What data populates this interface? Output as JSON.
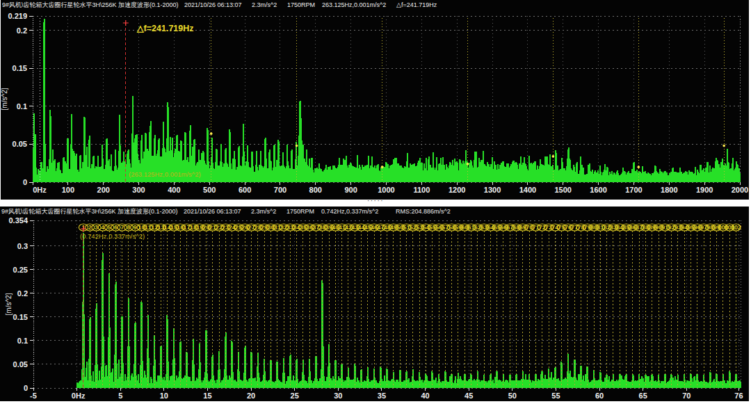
{
  "app": {
    "background": "#ffffff",
    "panel_background": "#040404"
  },
  "splitter": {
    "dots": "·····"
  },
  "panels": [
    {
      "header": {
        "title": "9#风机\\齿轮箱大齿圈行星轮水平3H\\256K 加速度波形(0.1-2000)",
        "datetime": "2021/10/26 06:13:07",
        "amplitude": "2.3m/s^2",
        "speed": "1750RPM",
        "cursor_readout": "263.125Hz,0.001m/s^2",
        "extra": "△f=241.719Hz"
      }
    },
    {
      "header": {
        "title": "9#风机\\齿轮箱大齿圈行星轮水平3H\\256K 加速度波形(0.1-2000)",
        "datetime": "2021/10/26 06:13:07",
        "amplitude": "2.3m/s^2",
        "speed": "1750RPM",
        "cursor_readout": "0.742Hz,0.337m/s^2",
        "extra": "RMS:204.886m/s^2"
      }
    }
  ],
  "chart_data": [
    {
      "type": "line",
      "kind": "fft-spectrum",
      "title": "9#风机\\齿轮箱大齿圈行星轮水平3H\\256K 加速度波形(0.1-2000)",
      "xlabel": "Hz",
      "ylabel": "[m/s^2]",
      "xlim": [
        0,
        2000
      ],
      "ylim": [
        0,
        0.219
      ],
      "grid": true,
      "legend": "none",
      "line_color": "#27e027",
      "xticks": [
        0,
        100,
        200,
        300,
        400,
        500,
        600,
        700,
        800,
        900,
        1000,
        1100,
        1200,
        1300,
        1400,
        1500,
        1600,
        1700,
        1800,
        1900,
        2000
      ],
      "xtick_labels": [
        "0Hz",
        "100",
        "200",
        "300",
        "400",
        "500",
        "600",
        "700",
        "800",
        "900",
        "1000",
        "1100",
        "1200",
        "1300",
        "1400",
        "1500",
        "1600",
        "1700",
        "1800",
        "1900",
        "2000"
      ],
      "yticks": [
        0,
        0.05,
        0.1,
        0.15,
        0.2,
        0.219
      ],
      "ytick_labels": [
        "0",
        "0.05",
        "0.1",
        "0.15",
        "0.2",
        "0.219"
      ],
      "annotations": {
        "delta_f": "△f=241.719Hz",
        "cursor_readout": "(263.125Hz,0.001m/s^2)"
      },
      "cursor": {
        "freq": 263.125,
        "amp": 0.001,
        "color": "#d43030",
        "style": "dashed"
      },
      "sideband_delta": 241.719,
      "sideband_cursors": [
        {
          "freq": 21.406,
          "color": "#e8e8e8"
        },
        {
          "freq": 504.844,
          "color": "#cdbd2e",
          "dot_amp": 0.064
        },
        {
          "freq": 746.563,
          "color": "#cdbd2e",
          "dot_amp": 0.048
        },
        {
          "freq": 988.281,
          "color": "#cdbd2e",
          "dot_amp": 0.02
        },
        {
          "freq": 1230.0,
          "color": "#cdbd2e",
          "dot_amp": 0.024
        },
        {
          "freq": 1471.719,
          "color": "#cdbd2e",
          "dot_amp": 0.034
        },
        {
          "freq": 1713.438,
          "color": "#cdbd2e",
          "dot_amp": 0.02
        },
        {
          "freq": 1955.156,
          "color": "#cdbd2e",
          "dot_amp": 0.048
        }
      ],
      "noise_floor": [
        [
          0,
          0.013
        ],
        [
          240,
          0.017
        ],
        [
          280,
          0.026
        ],
        [
          330,
          0.034
        ],
        [
          390,
          0.034
        ],
        [
          430,
          0.03
        ],
        [
          470,
          0.023
        ],
        [
          520,
          0.017
        ],
        [
          700,
          0.016
        ],
        [
          790,
          0.015
        ],
        [
          850,
          0.017
        ],
        [
          1000,
          0.018
        ],
        [
          1250,
          0.021
        ],
        [
          1400,
          0.02
        ],
        [
          1470,
          0.018
        ],
        [
          1560,
          0.012
        ],
        [
          1740,
          0.011
        ],
        [
          1870,
          0.011
        ],
        [
          1910,
          0.015
        ],
        [
          1955,
          0.018
        ],
        [
          2000,
          0.014
        ]
      ],
      "peaks": [
        [
          4,
          0.088
        ],
        [
          7,
          0.062
        ],
        [
          33,
          0.212,
          1.8
        ],
        [
          25,
          0.028
        ],
        [
          50,
          0.094
        ],
        [
          57,
          0.044
        ],
        [
          63,
          0.03
        ],
        [
          75,
          0.028
        ],
        [
          87,
          0.032
        ],
        [
          99,
          0.057
        ],
        [
          110,
          0.093
        ],
        [
          117,
          0.04
        ],
        [
          123,
          0.038
        ],
        [
          135,
          0.036
        ],
        [
          147,
          0.091
        ],
        [
          153,
          0.05
        ],
        [
          160,
          0.06
        ],
        [
          172,
          0.036
        ],
        [
          185,
          0.036
        ],
        [
          197,
          0.052
        ],
        [
          209,
          0.057
        ],
        [
          222,
          0.036
        ],
        [
          234,
          0.042
        ],
        [
          246,
          0.092
        ],
        [
          258,
          0.042
        ],
        [
          270,
          0.042
        ],
        [
          283,
          0.117
        ],
        [
          290,
          0.06
        ],
        [
          295,
          0.068
        ],
        [
          308,
          0.048
        ],
        [
          320,
          0.066
        ],
        [
          333,
          0.078
        ],
        [
          345,
          0.062
        ],
        [
          357,
          0.057
        ],
        [
          370,
          0.077
        ],
        [
          382,
          0.107
        ],
        [
          389,
          0.06
        ],
        [
          395,
          0.058
        ],
        [
          408,
          0.062
        ],
        [
          420,
          0.057
        ],
        [
          432,
          0.064
        ],
        [
          445,
          0.072
        ],
        [
          457,
          0.057
        ],
        [
          470,
          0.042
        ],
        [
          483,
          0.042
        ],
        [
          495,
          0.072
        ],
        [
          507,
          0.058
        ],
        [
          520,
          0.044
        ],
        [
          533,
          0.054
        ],
        [
          546,
          0.044
        ],
        [
          558,
          0.067
        ],
        [
          570,
          0.044
        ],
        [
          583,
          0.049
        ],
        [
          596,
          0.074
        ],
        [
          608,
          0.048
        ],
        [
          620,
          0.042
        ],
        [
          633,
          0.044
        ],
        [
          645,
          0.042
        ],
        [
          658,
          0.057
        ],
        [
          670,
          0.042
        ],
        [
          683,
          0.048
        ],
        [
          695,
          0.057
        ],
        [
          708,
          0.042
        ],
        [
          720,
          0.048
        ],
        [
          733,
          0.044
        ],
        [
          745,
          0.054
        ],
        [
          753,
          0.062
        ],
        [
          756,
          0.116
        ],
        [
          758,
          0.085
        ],
        [
          761,
          0.055
        ],
        [
          765,
          0.05
        ],
        [
          775,
          0.042
        ],
        [
          790,
          0.032
        ],
        [
          810,
          0.026
        ],
        [
          830,
          0.024
        ],
        [
          850,
          0.022
        ],
        [
          875,
          0.024
        ],
        [
          900,
          0.026
        ],
        [
          925,
          0.022
        ],
        [
          950,
          0.024
        ],
        [
          975,
          0.022
        ],
        [
          1000,
          0.026
        ],
        [
          1030,
          0.024
        ],
        [
          1060,
          0.024
        ],
        [
          1090,
          0.028
        ],
        [
          1120,
          0.026
        ],
        [
          1150,
          0.024
        ],
        [
          1180,
          0.026
        ],
        [
          1210,
          0.028
        ],
        [
          1240,
          0.03
        ],
        [
          1270,
          0.03
        ],
        [
          1300,
          0.032
        ],
        [
          1330,
          0.028
        ],
        [
          1360,
          0.028
        ],
        [
          1390,
          0.028
        ],
        [
          1420,
          0.03
        ],
        [
          1450,
          0.034
        ],
        [
          1480,
          0.042
        ],
        [
          1497,
          0.048,
          5
        ],
        [
          1515,
          0.053,
          7
        ],
        [
          1530,
          0.046,
          5
        ],
        [
          1550,
          0.036
        ],
        [
          1575,
          0.026
        ],
        [
          1625,
          0.02
        ],
        [
          1700,
          0.026
        ],
        [
          1725,
          0.022
        ],
        [
          1880,
          0.018
        ],
        [
          1915,
          0.034,
          5
        ],
        [
          1935,
          0.048,
          7
        ],
        [
          1950,
          0.056,
          7
        ],
        [
          1965,
          0.05,
          6
        ],
        [
          1980,
          0.036,
          5
        ],
        [
          1993,
          0.024
        ]
      ]
    },
    {
      "type": "line",
      "kind": "fft-spectrum-zoom",
      "title": "9#风机\\齿轮箱大齿圈行星轮水平3H\\256K 加速度波形(0.1-2000)",
      "xlabel": "Hz",
      "ylabel": "[m/s^2]",
      "xlim": [
        -5,
        76.2
      ],
      "ylim": [
        0,
        0.354
      ],
      "grid": true,
      "legend": "none",
      "line_color": "#27e027",
      "xticks": [
        -5,
        0,
        5,
        10,
        15,
        20,
        25,
        30,
        35,
        40,
        45,
        50,
        55,
        60,
        65,
        70,
        76
      ],
      "xtick_labels": [
        "-5",
        "0Hz",
        "5",
        "10",
        "15",
        "20",
        "25",
        "30",
        "35",
        "40",
        "45",
        "50",
        "55",
        "60",
        "65",
        "70",
        "76"
      ],
      "yticks": [
        0,
        0.05,
        0.1,
        0.15,
        0.2,
        0.25,
        0.3,
        0.354
      ],
      "ytick_labels": [
        "0",
        "0.05",
        "0.1",
        "0.15",
        "0.2",
        "0.25",
        "0.3",
        "0.354"
      ],
      "annotations": {
        "cursor_readout": "(0.742Hz,0.337m/s^2)",
        "rms": "RMS:204.886m/s^2"
      },
      "cursor": {
        "freq": 0.742,
        "amp": 0.337,
        "color": "#d43030",
        "style": "dashed"
      },
      "harmonics": {
        "fundamental_hz": 0.742,
        "count": 102,
        "line_color": "#b5a62c",
        "circle_color": "#ddca22",
        "amplitudes": [
          0.337,
          0.155,
          0.18,
          0.28,
          0.25,
          0.22,
          0.16,
          0.185,
          0.14,
          0.19,
          0.15,
          0.11,
          0.09,
          0.15,
          0.13,
          0.1,
          0.08,
          0.11,
          0.1,
          0.12,
          0.07,
          0.08,
          0.115,
          0.1,
          0.08,
          0.09,
          0.075,
          0.08,
          0.065,
          0.06,
          0.055,
          0.065,
          0.07,
          0.06,
          0.065,
          0.06,
          0.07,
          0.235,
          0.1,
          0.06,
          0.05,
          0.045,
          0.05,
          0.04,
          0.045,
          0.04,
          0.045,
          0.04,
          0.035,
          0.04,
          0.035,
          0.04,
          0.035,
          0.03,
          0.035,
          0.03,
          0.035,
          0.03,
          0.035,
          0.03,
          0.03,
          0.035,
          0.03,
          0.03,
          0.035,
          0.03,
          0.03,
          0.03,
          0.035,
          0.03,
          0.03,
          0.035,
          0.04,
          0.045,
          0.055,
          0.07,
          0.06,
          0.05,
          0.045,
          0.04,
          0.035,
          0.03,
          0.03,
          0.03,
          0.03,
          0.03,
          0.03,
          0.03,
          0.03,
          0.03,
          0.03,
          0.03,
          0.03,
          0.03,
          0.03,
          0.03,
          0.03,
          0.035,
          0.03,
          0.03,
          0.035,
          0.03
        ]
      },
      "noise_floor": [
        [
          0,
          0.012
        ],
        [
          10,
          0.013
        ],
        [
          30,
          0.013
        ],
        [
          50,
          0.013
        ],
        [
          54,
          0.016
        ],
        [
          56.5,
          0.02
        ],
        [
          58.5,
          0.014
        ],
        [
          70,
          0.012
        ],
        [
          76.2,
          0.012
        ]
      ]
    }
  ]
}
